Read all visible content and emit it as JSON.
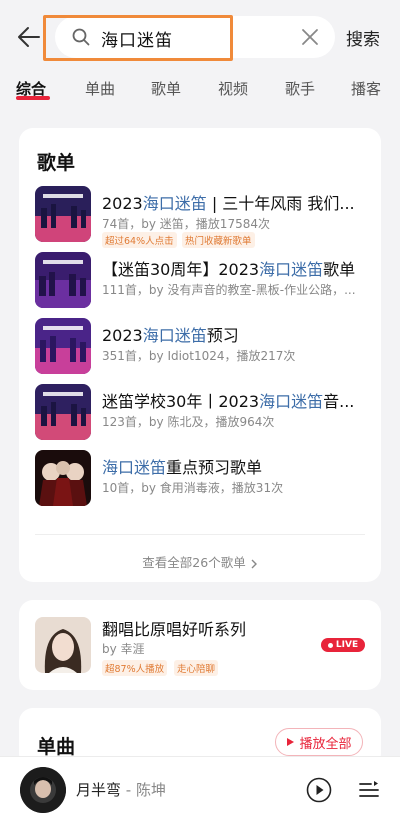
{
  "search": {
    "query": "海口迷笛",
    "button_label": "搜索"
  },
  "tabs": [
    {
      "label": "综合"
    },
    {
      "label": "单曲"
    },
    {
      "label": "歌单"
    },
    {
      "label": "视频"
    },
    {
      "label": "歌手"
    },
    {
      "label": "播客"
    }
  ],
  "playlists_section": {
    "title": "歌单",
    "items": [
      {
        "title_pre": "2023",
        "title_hl": "海口迷笛",
        "title_post": " | 三十年风雨 我们...",
        "sub": "74首，by 迷笛，播放17584次",
        "tags": [
          "超过64%人点击",
          "热门收藏新歌单"
        ]
      },
      {
        "title_pre": "【迷笛30周年】2023",
        "title_hl": "海口迷笛",
        "title_post": "歌单",
        "sub": "111首，by 没有声音的教室-黑板-作业公路，...",
        "tags": []
      },
      {
        "title_pre": "2023",
        "title_hl": "海口迷笛",
        "title_post": "预习",
        "sub": "351首，by Idiot1024，播放217次",
        "tags": []
      },
      {
        "title_pre": "迷笛学校30年丨2023",
        "title_hl": "海口迷笛",
        "title_post": "音...",
        "sub": "123首，by 陈北及，播放964次",
        "tags": []
      },
      {
        "title_pre": "",
        "title_hl": "海口迷笛",
        "title_post": "重点预习歌单",
        "sub": "10首，by 食用消毒液，播放31次",
        "tags": []
      }
    ],
    "view_all": "查看全部26个歌单"
  },
  "live_card": {
    "title": "翻唱比原唱好听系列",
    "by_prefix": "by",
    "by_name": "幸涯",
    "tags": [
      "超87%人播放",
      "走心陪聊"
    ],
    "badge": "LIVE"
  },
  "songs_section": {
    "title": "单曲",
    "play_all": "播放全部"
  },
  "player": {
    "song": "月半弯",
    "separator": " - ",
    "artist": "陈坤"
  },
  "colors": {
    "accent_red": "#e8243a",
    "highlight_blue": "#3d6da8",
    "tag_orange": "#e07b35",
    "annotation_box": "#f08a3a"
  }
}
